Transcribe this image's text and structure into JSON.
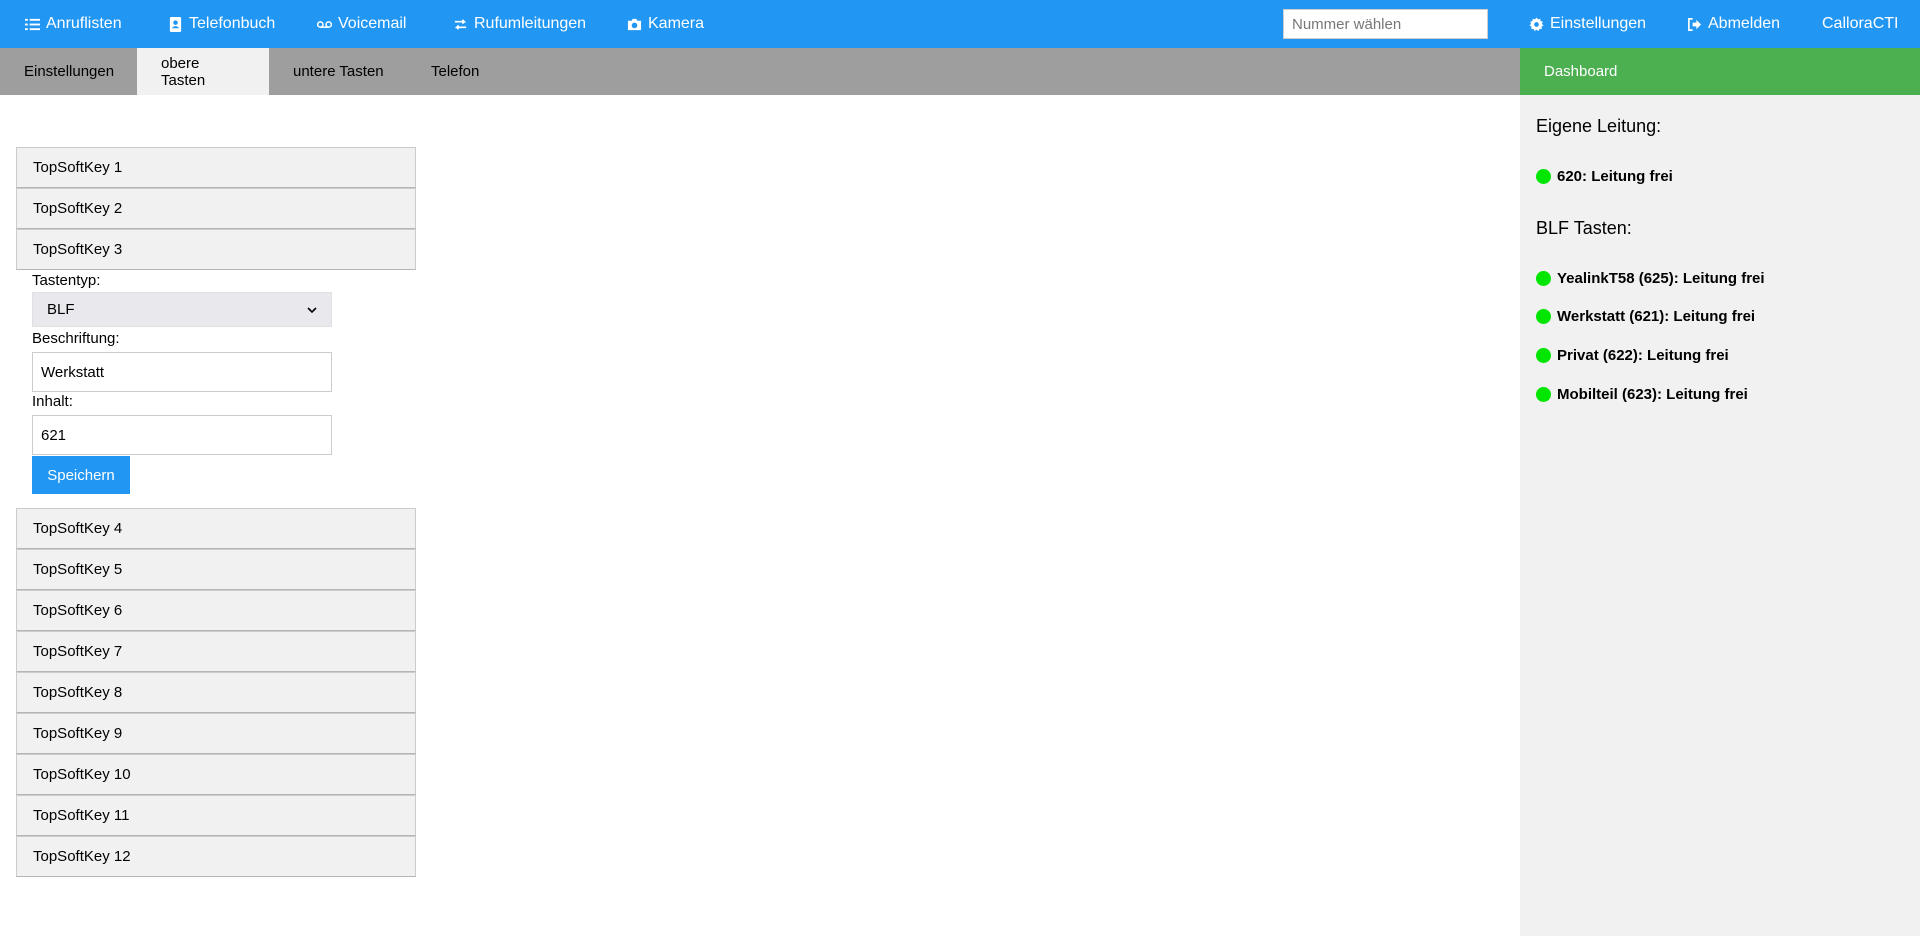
{
  "topnav": {
    "items": [
      {
        "label": "Anruflisten",
        "icon": "list-icon"
      },
      {
        "label": "Telefonbuch",
        "icon": "address-book-icon"
      },
      {
        "label": "Voicemail",
        "icon": "voicemail-icon"
      },
      {
        "label": "Rufumleitungen",
        "icon": "redirect-icon"
      },
      {
        "label": "Kamera",
        "icon": "camera-icon"
      }
    ],
    "dial_placeholder": "Nummer wählen",
    "settings_label": "Einstellungen",
    "logout_label": "Abmelden",
    "brand": "CalloraCTI"
  },
  "tabs": [
    {
      "label": "Einstellungen",
      "active": false
    },
    {
      "label": "obere Tasten",
      "active": true
    },
    {
      "label": "untere Tasten",
      "active": false
    },
    {
      "label": "Telefon",
      "active": false
    }
  ],
  "dashboard_tab": "Dashboard",
  "keys_before": [
    "TopSoftKey 1",
    "TopSoftKey 2",
    "TopSoftKey 3"
  ],
  "form": {
    "type_label": "Tastentyp:",
    "type_value": "BLF",
    "caption_label": "Beschriftung:",
    "caption_value": "Werkstatt",
    "content_label": "Inhalt:",
    "content_value": "621",
    "save_label": "Speichern"
  },
  "keys_after": [
    "TopSoftKey 4",
    "TopSoftKey 5",
    "TopSoftKey 6",
    "TopSoftKey 7",
    "TopSoftKey 8",
    "TopSoftKey 9",
    "TopSoftKey 10",
    "TopSoftKey 11",
    "TopSoftKey 12"
  ],
  "side": {
    "own_line_heading": "Eigene Leitung:",
    "own_line": "620: Leitung frei",
    "blf_heading": "BLF Tasten:",
    "blf_items": [
      "YealinkT58 (625): Leitung frei",
      "Werkstatt (621): Leitung frei",
      "Privat (622): Leitung frei",
      "Mobilteil (623): Leitung frei"
    ],
    "status_color": "#00e600"
  },
  "colors": {
    "primary": "#2196F3",
    "dashboard": "#4CAF50",
    "tabbar": "#9e9e9e"
  }
}
